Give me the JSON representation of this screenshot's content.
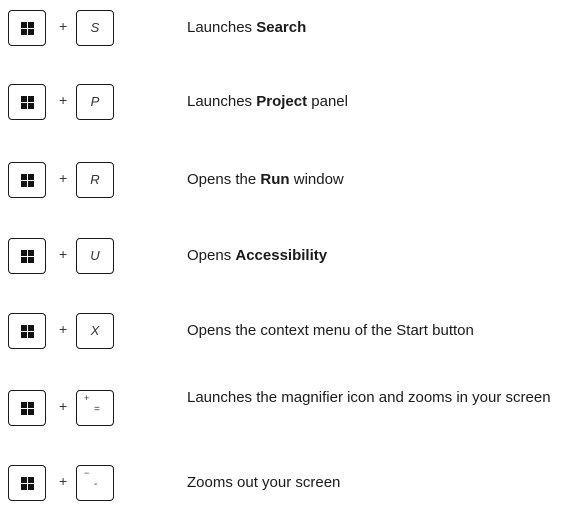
{
  "plus_sign": "+",
  "shortcuts": [
    {
      "key": "S",
      "desc_before": "Launches ",
      "desc_bold": "Search",
      "desc_after": ""
    },
    {
      "key": "P",
      "desc_before": "Launches ",
      "desc_bold": "Project",
      "desc_after": " panel"
    },
    {
      "key": "R",
      "desc_before": "Opens the ",
      "desc_bold": "Run",
      "desc_after": " window"
    },
    {
      "key": "U",
      "desc_before": "Opens ",
      "desc_bold": "Accessibility",
      "desc_after": ""
    },
    {
      "key": "X",
      "desc_before": "Opens the context menu of the Start button",
      "desc_bold": "",
      "desc_after": ""
    },
    {
      "key_top": "+",
      "key_bottom": "=",
      "desc_before": "Launches the magnifier icon and zooms in your screen",
      "desc_bold": "",
      "desc_after": ""
    },
    {
      "key_top": "−",
      "key_bottom": "-",
      "desc_before": "Zooms out your screen",
      "desc_bold": "",
      "desc_after": ""
    }
  ]
}
